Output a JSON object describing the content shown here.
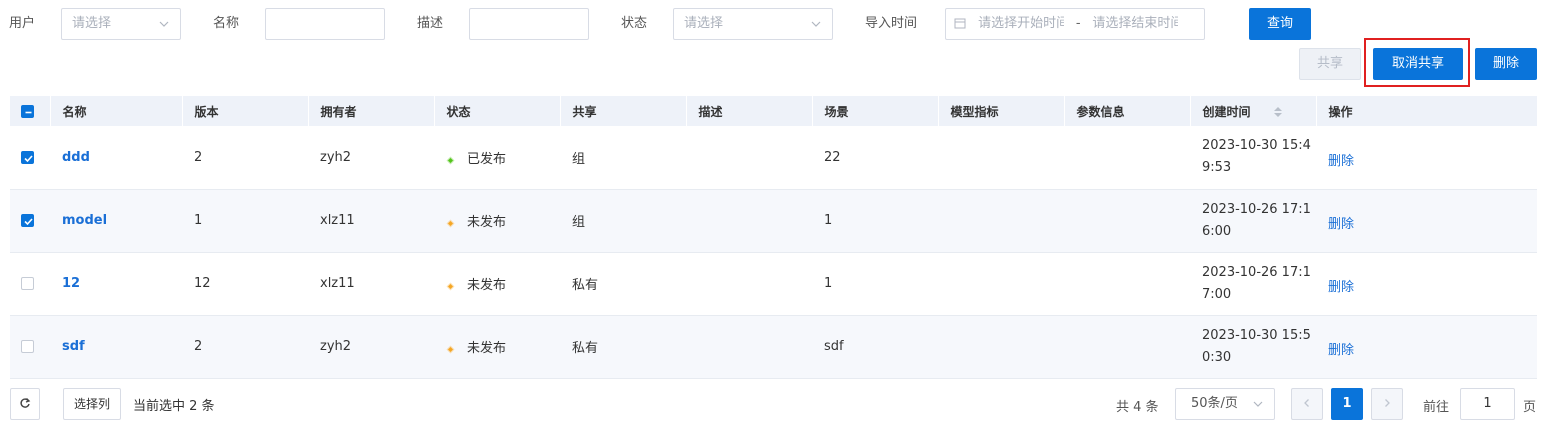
{
  "filters": {
    "user": {
      "label": "用户",
      "placeholder": "请选择"
    },
    "name": {
      "label": "名称",
      "value": ""
    },
    "desc": {
      "label": "描述",
      "value": ""
    },
    "status": {
      "label": "状态",
      "placeholder": "请选择"
    },
    "import_time": {
      "label": "导入时间",
      "start_placeholder": "请选择开始时间",
      "separator": "-",
      "end_placeholder": "请选择结束时间"
    },
    "query_label": "查询"
  },
  "toolbar": {
    "share_label": "共享",
    "unshare_label": "取消共享",
    "delete_label": "删除"
  },
  "colors": {
    "primary": "#0a74da",
    "published": "#52c41a",
    "unpublished": "#f5a623",
    "highlight": "#e02020"
  },
  "table": {
    "columns": [
      "名称",
      "版本",
      "拥有者",
      "状态",
      "共享",
      "描述",
      "场景",
      "模型指标",
      "参数信息",
      "创建时间",
      "操作"
    ],
    "rows": [
      {
        "checked": true,
        "name": "ddd",
        "version": "2",
        "owner": "zyh2",
        "status": "已发布",
        "status_kind": "published",
        "share": "组",
        "desc": "",
        "scene": "22",
        "metric": "",
        "params": "",
        "created": "2023-10-30 15:4\n9:53",
        "action": "删除"
      },
      {
        "checked": true,
        "name": "model",
        "version": "1",
        "owner": "xlz11",
        "status": "未发布",
        "status_kind": "unpublished",
        "share": "组",
        "desc": "",
        "scene": "1",
        "metric": "",
        "params": "",
        "created": "2023-10-26 17:1\n6:00",
        "action": "删除"
      },
      {
        "checked": false,
        "name": "12",
        "version": "12",
        "owner": "xlz11",
        "status": "未发布",
        "status_kind": "unpublished",
        "share": "私有",
        "desc": "",
        "scene": "1",
        "metric": "",
        "params": "",
        "created": "2023-10-26 17:1\n7:00",
        "action": "删除"
      },
      {
        "checked": false,
        "name": "sdf",
        "version": "2",
        "owner": "zyh2",
        "status": "未发布",
        "status_kind": "unpublished",
        "share": "私有",
        "desc": "",
        "scene": "sdf",
        "metric": "",
        "params": "",
        "created": "2023-10-30 15:5\n0:30",
        "action": "删除"
      }
    ]
  },
  "footer": {
    "select_columns_label": "选择列",
    "selected_text": "当前选中 2 条",
    "total_text": "共 4 条",
    "page_size": "50条/页",
    "current_page": "1",
    "goto_label": "前往",
    "goto_value": "1",
    "page_unit": "页"
  }
}
